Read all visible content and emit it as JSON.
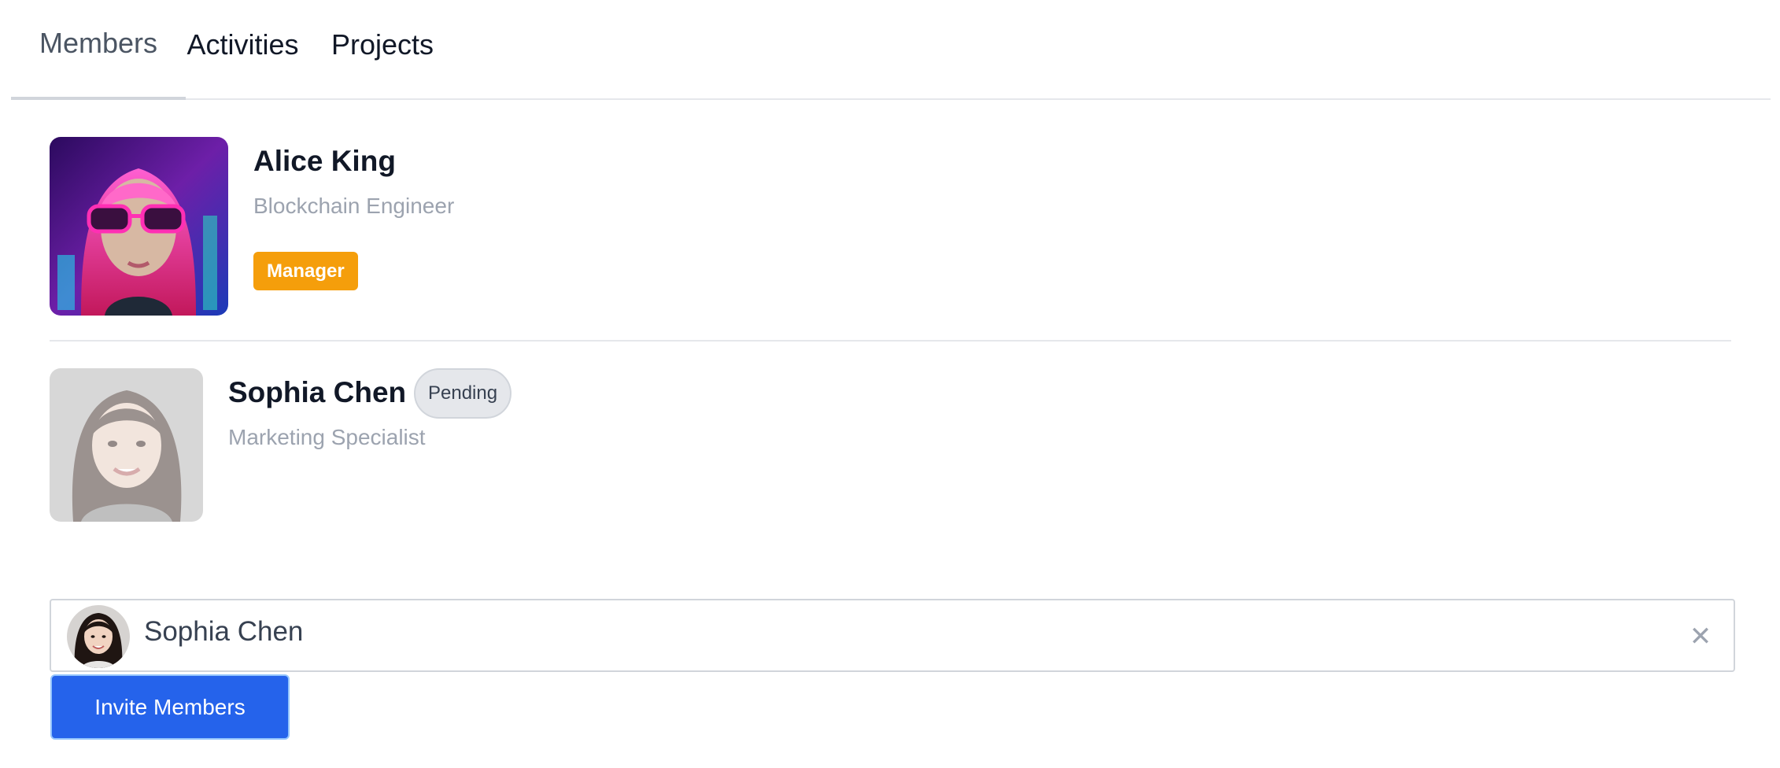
{
  "tabs": [
    {
      "label": "Members",
      "active": true
    },
    {
      "label": "Activities",
      "active": false
    },
    {
      "label": "Projects",
      "active": false
    }
  ],
  "members": [
    {
      "name": "Alice King",
      "role": "Blockchain Engineer",
      "badge": "Manager",
      "badge_color": "#f59e0b"
    },
    {
      "name": "Sophia Chen",
      "role": "Marketing Specialist",
      "status": "Pending"
    }
  ],
  "invite": {
    "selected_name": "Sophia Chen",
    "button_label": "Invite Members",
    "clear_icon": "close-icon"
  },
  "colors": {
    "primary": "#2563eb",
    "manager_badge": "#f59e0b",
    "pending_badge": "#e5e7eb"
  }
}
